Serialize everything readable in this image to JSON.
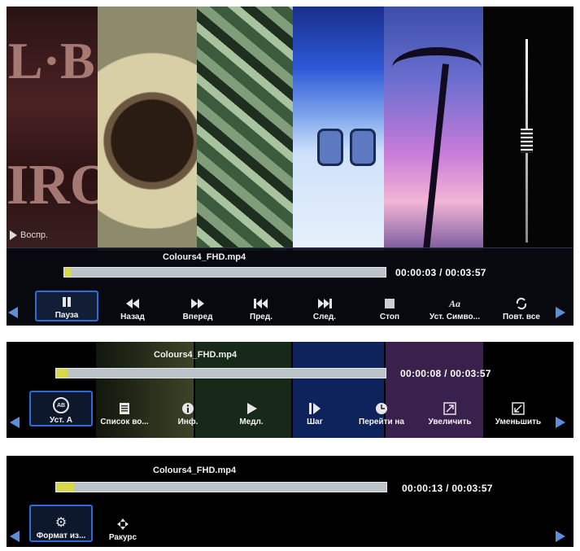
{
  "panel1": {
    "overlay_hint": "Воспр.",
    "filename": "Colours4_FHD.mp4",
    "time": "00:00:03 / 00:03:57",
    "progress": 0.013,
    "buttons": [
      {
        "label": "Пауза",
        "icon": "pause-icon"
      },
      {
        "label": "Назад",
        "icon": "rewind-icon"
      },
      {
        "label": "Вперед",
        "icon": "fast-forward-icon"
      },
      {
        "label": "Пред.",
        "icon": "skip-previous-icon"
      },
      {
        "label": "След.",
        "icon": "skip-next-icon"
      },
      {
        "label": "Стоп",
        "icon": "stop-icon"
      },
      {
        "label": "Уст. Симво...",
        "icon": "subtitle-icon"
      },
      {
        "label": "Повт. все",
        "icon": "repeat-icon"
      }
    ],
    "selected_index": 0
  },
  "panel2": {
    "filename": "Colours4_FHD.mp4",
    "time": "00:00:08 / 00:03:57",
    "progress": 0.034,
    "buttons": [
      {
        "label": "Уст. А",
        "icon": "ab-repeat-icon"
      },
      {
        "label": "Список во...",
        "icon": "playlist-icon"
      },
      {
        "label": "Инф.",
        "icon": "info-icon"
      },
      {
        "label": "Медл.",
        "icon": "slow-motion-icon"
      },
      {
        "label": "Шаг",
        "icon": "step-icon"
      },
      {
        "label": "Перейти на",
        "icon": "goto-time-icon"
      },
      {
        "label": "Увеличить",
        "icon": "zoom-in-icon"
      },
      {
        "label": "Уменьшить",
        "icon": "zoom-out-icon"
      }
    ],
    "selected_index": 0
  },
  "panel3": {
    "filename": "Colours4_FHD.mp4",
    "time": "00:00:13 / 00:03:57",
    "progress": 0.055,
    "buttons": [
      {
        "label": "Формат из...",
        "icon": "gear-icon"
      },
      {
        "label": "Ракурс",
        "icon": "move-icon"
      }
    ],
    "selected_index": 0
  },
  "colors": {
    "accent": "#2c6bd8",
    "arrow": "#5b8fd9",
    "progress_fill": "#d7d84a",
    "progress_track": "#bcc3c9"
  }
}
